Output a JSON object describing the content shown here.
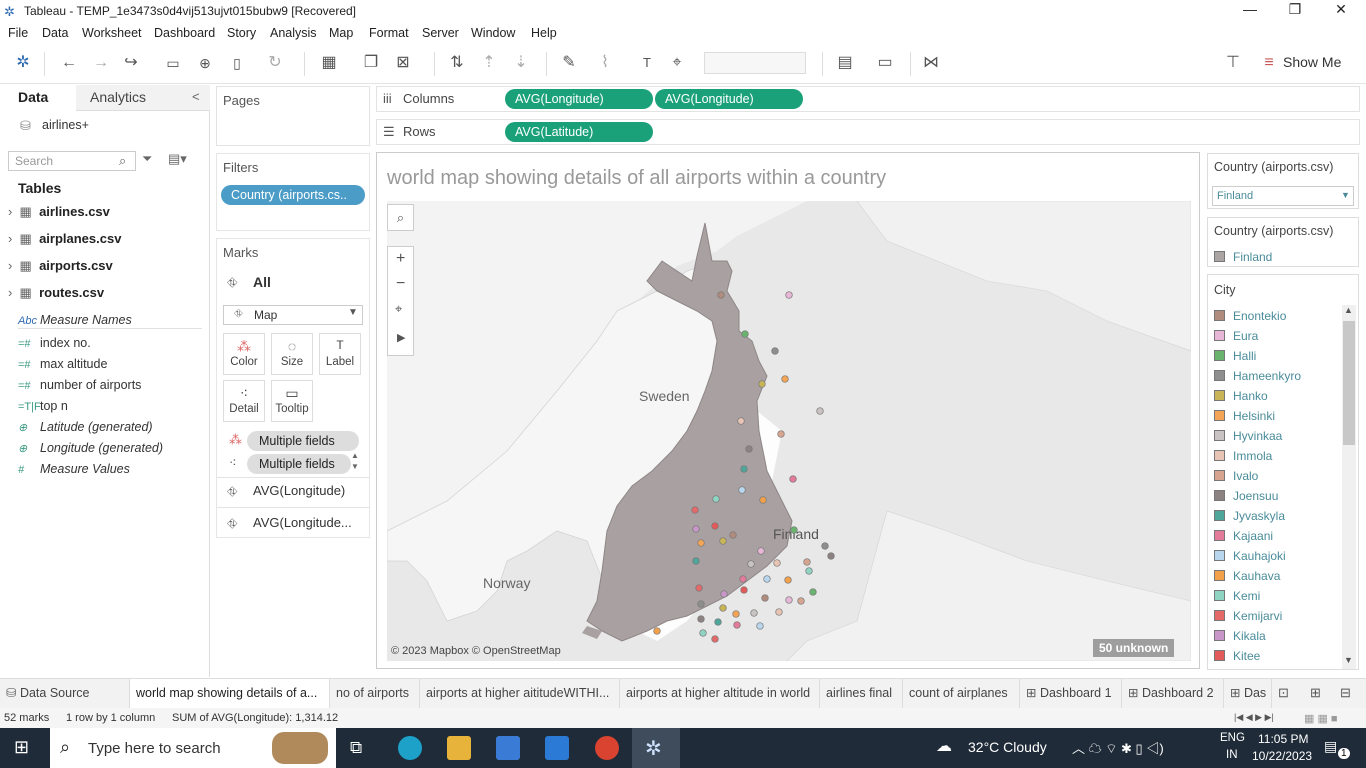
{
  "window": {
    "title": "Tableau - TEMP_1e3473s0d4vij513ujvt015bubw9 [Recovered]",
    "minimize": "—",
    "restore": "❐",
    "close": "✕"
  },
  "menu": [
    "File",
    "Data",
    "Worksheet",
    "Dashboard",
    "Story",
    "Analysis",
    "Map",
    "Format",
    "Server",
    "Window",
    "Help"
  ],
  "toolbar": {
    "show_me": "Show Me"
  },
  "left_pane": {
    "tab_data": "Data",
    "tab_analytics": "Analytics",
    "datasource": "airlines+",
    "search_placeholder": "Search",
    "tables_heading": "Tables",
    "tables": [
      "airlines.csv",
      "airplanes.csv",
      "airports.csv",
      "routes.csv"
    ],
    "fields": [
      {
        "icon": "Abc",
        "label": "Measure Names",
        "italic": true
      },
      {
        "icon": "=#",
        "label": "index no.",
        "italic": false
      },
      {
        "icon": "=#",
        "label": "max altitude",
        "italic": false
      },
      {
        "icon": "=#",
        "label": "number of airports",
        "italic": false
      },
      {
        "icon": "=T|F",
        "label": "top n",
        "italic": false
      },
      {
        "icon": "globe",
        "label": "Latitude (generated)",
        "italic": true
      },
      {
        "icon": "globe",
        "label": "Longitude (generated)",
        "italic": true
      },
      {
        "icon": "#",
        "label": "Measure Values",
        "italic": true
      }
    ]
  },
  "pages_label": "Pages",
  "filters": {
    "label": "Filters",
    "pill": "Country (airports.cs.."
  },
  "marks": {
    "label": "Marks",
    "all": "All",
    "type": "Map",
    "buttons": [
      "Color",
      "Size",
      "Label",
      "Detail",
      "Tooltip"
    ],
    "pills": [
      "Multiple fields",
      "Multiple fields"
    ],
    "cards": [
      "AVG(Longitude)",
      "AVG(Longitude..."
    ]
  },
  "shelves": {
    "columns_label": "Columns",
    "rows_label": "Rows",
    "columns": [
      "AVG(Longitude)",
      "AVG(Longitude)"
    ],
    "rows": [
      "AVG(Latitude)"
    ]
  },
  "viz": {
    "title": "world map showing details of all airports within a country",
    "map_labels": {
      "sweden": "Sweden",
      "finland": "Finland",
      "norway": "Norway"
    },
    "attribution": "© 2023 Mapbox © OpenStreetMap",
    "unknown": "50 unknown"
  },
  "filter_card": {
    "title": "Country (airports.csv)",
    "value": "Finland"
  },
  "country_legend": {
    "title": "Country (airports.csv)",
    "item": "Finland",
    "color": "#aaa4a4"
  },
  "city_legend": {
    "title": "City",
    "items": [
      {
        "name": "Enontekio",
        "color": "#b08c7e"
      },
      {
        "name": "Eura",
        "color": "#e8b6d6"
      },
      {
        "name": "Halli",
        "color": "#6ab36e"
      },
      {
        "name": "Hameenkyro",
        "color": "#8e8e8e"
      },
      {
        "name": "Hanko",
        "color": "#c9b457"
      },
      {
        "name": "Helsinki",
        "color": "#f3a455"
      },
      {
        "name": "Hyvinkaa",
        "color": "#c9c3c3"
      },
      {
        "name": "Immola",
        "color": "#e8c4b4"
      },
      {
        "name": "Ivalo",
        "color": "#d7a48f"
      },
      {
        "name": "Joensuu",
        "color": "#8c8282"
      },
      {
        "name": "Jyvaskyla",
        "color": "#4ea59a"
      },
      {
        "name": "Kajaani",
        "color": "#e27a9a"
      },
      {
        "name": "Kauhajoki",
        "color": "#b8d7ee"
      },
      {
        "name": "Kauhava",
        "color": "#f2a04a"
      },
      {
        "name": "Kemi",
        "color": "#8fd3c3"
      },
      {
        "name": "Kemijarvi",
        "color": "#e46a6a"
      },
      {
        "name": "Kikala",
        "color": "#c896c8"
      },
      {
        "name": "Kitee",
        "color": "#e35a5a"
      }
    ]
  },
  "sheet_tabs": [
    "Data Source",
    "world map showing details of a...",
    "no of airports",
    "airports at higher aititudeWITHI...",
    "airports at higher altitude in world",
    "airlines final",
    "count of airplanes",
    "Dashboard 1",
    "Dashboard 2",
    "Das"
  ],
  "status": {
    "marks": "52 marks",
    "rows": "1 row by 1 column",
    "sum": "SUM of AVG(Longitude): 1,314.12"
  },
  "taskbar": {
    "search": "Type here to search",
    "weather": "32°C  Cloudy",
    "lang": "ENG",
    "region": "IN",
    "time": "11:05 PM",
    "date": "10/22/2023",
    "notif": "1"
  }
}
